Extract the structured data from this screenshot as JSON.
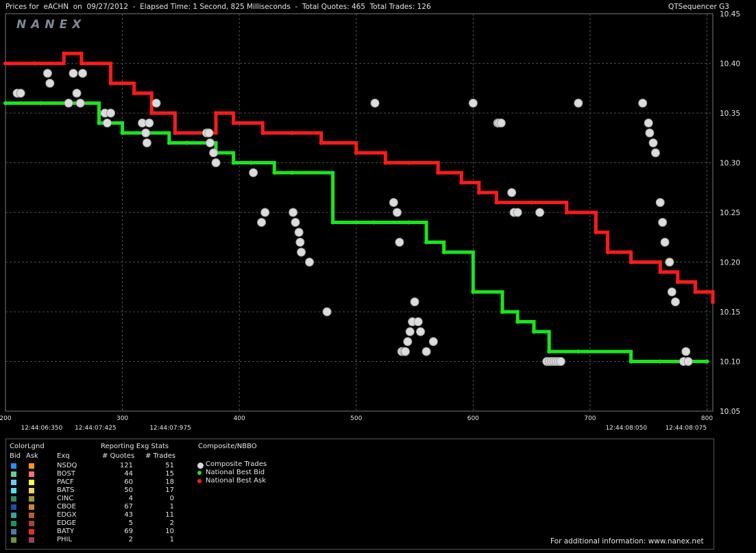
{
  "header": {
    "title": "Prices for  eACHN  on  09/27/2012  -  Elapsed Time: 1 Second, 825 Milliseconds  -  Total Quotes: 465  Total Trades: 126",
    "product": "QTSequencer G3",
    "watermark": "NANEX"
  },
  "footer": {
    "info": "For additional information: www.nanex.net"
  },
  "legend": {
    "colorlgnd": "ColorLgnd",
    "bid_hdr": "Bid",
    "ask_hdr": "Ask",
    "exq_hdr": "Exq",
    "stats_hdr": "Reporting Exg Stats",
    "quotes_hdr": "# Quotes",
    "trades_hdr": "# Trades",
    "composite_hdr": "Composite/NBBO",
    "composite_items": [
      {
        "label": "Composite Trades",
        "color": "#d9d9d9"
      },
      {
        "label": "National Best Bid",
        "color": "#19e619"
      },
      {
        "label": "National Best Ask",
        "color": "#ff1a1a"
      }
    ],
    "exchanges": [
      {
        "name": "NSDQ",
        "quotes": "121",
        "trades": "51",
        "bid_color": "#1e90ff",
        "ask_color": "#ff9900"
      },
      {
        "name": "BOST",
        "quotes": "44",
        "trades": "15",
        "bid_color": "#66cc99",
        "ask_color": "#ff6f6f"
      },
      {
        "name": "PACF",
        "quotes": "60",
        "trades": "18",
        "bid_color": "#66ccff",
        "ask_color": "#ffff33"
      },
      {
        "name": "BATS",
        "quotes": "50",
        "trades": "17",
        "bid_color": "#55ddee",
        "ask_color": "#ffcc66"
      },
      {
        "name": "CINC",
        "quotes": "4",
        "trades": "0",
        "bid_color": "#2e8b57",
        "ask_color": "#999933"
      },
      {
        "name": "CBOE",
        "quotes": "67",
        "trades": "1",
        "bid_color": "#1f4fa8",
        "ask_color": "#cc8833"
      },
      {
        "name": "EDGX",
        "quotes": "43",
        "trades": "11",
        "bid_color": "#3aa0a0",
        "ask_color": "#b85c3a"
      },
      {
        "name": "EDGE",
        "quotes": "5",
        "trades": "2",
        "bid_color": "#209060",
        "ask_color": "#aa4433"
      },
      {
        "name": "BATY",
        "quotes": "69",
        "trades": "10",
        "bid_color": "#4a7ab0",
        "ask_color": "#dd3311"
      },
      {
        "name": "PHIL",
        "quotes": "2",
        "trades": "1",
        "bid_color": "#669933",
        "ask_color": "#994455"
      }
    ]
  },
  "chart_data": {
    "type": "line",
    "xlim": [
      200,
      805
    ],
    "ylim": [
      10.05,
      10.45
    ],
    "x_ticks": [
      200,
      300,
      400,
      500,
      600,
      700,
      800
    ],
    "y_ticks": [
      10.05,
      10.1,
      10.15,
      10.2,
      10.25,
      10.3,
      10.35,
      10.4,
      10.45
    ],
    "y_tick_labels": [
      "10.05",
      "10.10",
      "10.15",
      "10.20",
      "10.25",
      "10.30",
      "10.35",
      "10.40",
      "10.45"
    ],
    "time_labels": [
      {
        "x": 231,
        "label": "12:44:06:350"
      },
      {
        "x": 277,
        "label": "12:44:07:425"
      },
      {
        "x": 341,
        "label": "12:44:07:975"
      },
      {
        "x": 731,
        "label": "12:44:08:050"
      },
      {
        "x": 782,
        "label": "12:44:08:075"
      }
    ],
    "grid": true,
    "series": [
      {
        "name": "National Best Bid",
        "color": "#19e619",
        "points": [
          [
            200,
            10.36
          ],
          [
            230,
            10.36
          ],
          [
            262,
            10.36
          ],
          [
            280,
            10.34
          ],
          [
            300,
            10.33
          ],
          [
            340,
            10.32
          ],
          [
            355,
            10.32
          ],
          [
            380,
            10.31
          ],
          [
            395,
            10.3
          ],
          [
            410,
            10.3
          ],
          [
            430,
            10.29
          ],
          [
            445,
            10.29
          ],
          [
            480,
            10.24
          ],
          [
            515,
            10.24
          ],
          [
            545,
            10.24
          ],
          [
            560,
            10.22
          ],
          [
            575,
            10.21
          ],
          [
            600,
            10.17
          ],
          [
            625,
            10.15
          ],
          [
            638,
            10.14
          ],
          [
            652,
            10.13
          ],
          [
            665,
            10.11
          ],
          [
            690,
            10.11
          ],
          [
            735,
            10.1
          ],
          [
            760,
            10.1
          ],
          [
            780,
            10.1
          ],
          [
            800,
            10.1
          ]
        ]
      },
      {
        "name": "National Best Ask",
        "color": "#ff1a1a",
        "points": [
          [
            200,
            10.4
          ],
          [
            225,
            10.4
          ],
          [
            250,
            10.41
          ],
          [
            265,
            10.4
          ],
          [
            290,
            10.38
          ],
          [
            310,
            10.37
          ],
          [
            325,
            10.35
          ],
          [
            345,
            10.33
          ],
          [
            380,
            10.35
          ],
          [
            395,
            10.34
          ],
          [
            420,
            10.33
          ],
          [
            445,
            10.33
          ],
          [
            470,
            10.32
          ],
          [
            500,
            10.31
          ],
          [
            525,
            10.3
          ],
          [
            545,
            10.3
          ],
          [
            570,
            10.29
          ],
          [
            590,
            10.28
          ],
          [
            605,
            10.27
          ],
          [
            620,
            10.26
          ],
          [
            650,
            10.26
          ],
          [
            680,
            10.25
          ],
          [
            705,
            10.23
          ],
          [
            715,
            10.21
          ],
          [
            735,
            10.2
          ],
          [
            760,
            10.19
          ],
          [
            775,
            10.18
          ],
          [
            790,
            10.17
          ],
          [
            805,
            10.16
          ]
        ]
      }
    ],
    "composite_trades": [
      [
        210,
        10.37
      ],
      [
        213,
        10.37
      ],
      [
        236,
        10.39
      ],
      [
        238,
        10.38
      ],
      [
        254,
        10.36
      ],
      [
        258,
        10.39
      ],
      [
        261,
        10.37
      ],
      [
        264,
        10.36
      ],
      [
        266,
        10.39
      ],
      [
        285,
        10.35
      ],
      [
        287,
        10.34
      ],
      [
        290,
        10.35
      ],
      [
        317,
        10.34
      ],
      [
        320,
        10.33
      ],
      [
        321,
        10.32
      ],
      [
        323,
        10.34
      ],
      [
        329,
        10.36
      ],
      [
        372,
        10.33
      ],
      [
        374,
        10.33
      ],
      [
        375,
        10.32
      ],
      [
        378,
        10.31
      ],
      [
        380,
        10.3
      ],
      [
        412,
        10.29
      ],
      [
        419,
        10.24
      ],
      [
        422,
        10.25
      ],
      [
        446,
        10.25
      ],
      [
        448,
        10.24
      ],
      [
        451,
        10.23
      ],
      [
        452,
        10.22
      ],
      [
        453,
        10.21
      ],
      [
        460,
        10.2
      ],
      [
        475,
        10.15
      ],
      [
        516,
        10.36
      ],
      [
        532,
        10.26
      ],
      [
        535,
        10.25
      ],
      [
        537,
        10.22
      ],
      [
        539,
        10.11
      ],
      [
        541,
        10.11
      ],
      [
        542,
        10.11
      ],
      [
        544,
        10.12
      ],
      [
        546,
        10.13
      ],
      [
        548,
        10.14
      ],
      [
        550,
        10.16
      ],
      [
        553,
        10.14
      ],
      [
        555,
        10.13
      ],
      [
        560,
        10.11
      ],
      [
        566,
        10.12
      ],
      [
        600,
        10.36
      ],
      [
        621,
        10.34
      ],
      [
        622,
        10.34
      ],
      [
        624,
        10.34
      ],
      [
        633,
        10.27
      ],
      [
        635,
        10.25
      ],
      [
        638,
        10.25
      ],
      [
        657,
        10.25
      ],
      [
        663,
        10.1
      ],
      [
        665,
        10.1
      ],
      [
        667,
        10.1
      ],
      [
        669,
        10.1
      ],
      [
        671,
        10.1
      ],
      [
        673,
        10.1
      ],
      [
        675,
        10.1
      ],
      [
        690,
        10.36
      ],
      [
        745,
        10.36
      ],
      [
        750,
        10.34
      ],
      [
        751,
        10.33
      ],
      [
        754,
        10.32
      ],
      [
        756,
        10.31
      ],
      [
        760,
        10.26
      ],
      [
        762,
        10.24
      ],
      [
        764,
        10.22
      ],
      [
        768,
        10.2
      ],
      [
        770,
        10.17
      ],
      [
        773,
        10.16
      ],
      [
        780,
        10.1
      ],
      [
        782,
        10.11
      ],
      [
        784,
        10.1
      ]
    ]
  }
}
